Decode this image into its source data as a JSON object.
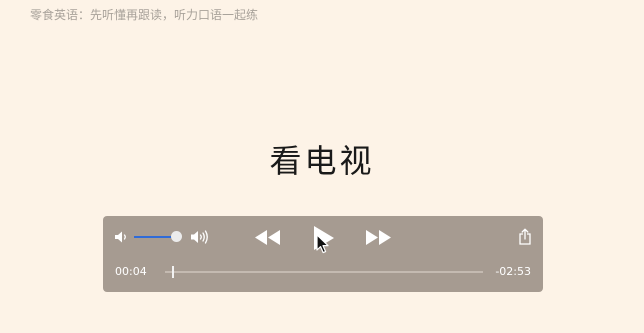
{
  "page": {
    "subtitle": "零食英语：先听懂再跟读，听力口语一起练",
    "title": "看电视"
  },
  "player": {
    "elapsed": "00:04",
    "remaining": "-02:53",
    "volume_level": 0.92,
    "progress_fraction": 0.023,
    "icons": {
      "volume_low": "speaker-low-icon",
      "volume_high": "speaker-high-icon",
      "rewind": "rewind-icon",
      "play": "play-icon",
      "fast_forward": "fast-forward-icon",
      "share": "share-icon"
    }
  },
  "colors": {
    "page_background": "#fdf3e7",
    "player_background": "#a69b91",
    "volume_accent": "#2f6bd8"
  }
}
